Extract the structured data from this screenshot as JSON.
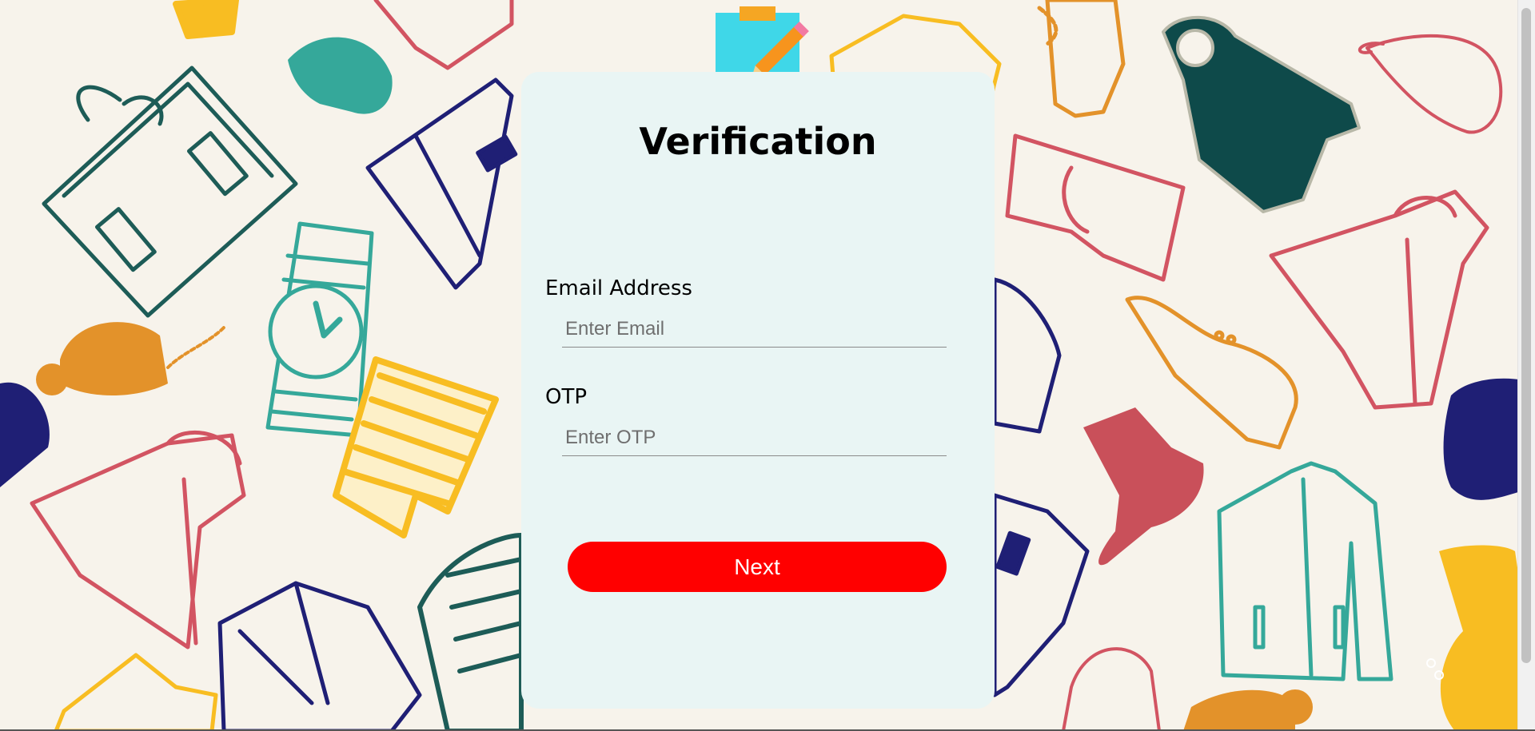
{
  "page": {
    "title": "Verification"
  },
  "form": {
    "email": {
      "label": "Email Address",
      "placeholder": "Enter Email",
      "value": ""
    },
    "otp": {
      "label": "OTP",
      "placeholder": "Enter OTP",
      "value": ""
    },
    "next_label": "Next"
  },
  "icons": {
    "header": "notepad-pencil-icon"
  },
  "colors": {
    "background": "#f7f3eb",
    "card": "#e9f5f4",
    "button": "#ff0000",
    "button_text": "#ffffff",
    "navy": "#1f1f75",
    "teal": "#35a89a",
    "dark_teal": "#1d5c57",
    "orange": "#e3922a",
    "yellow": "#f8bd22",
    "red": "#d25462"
  }
}
